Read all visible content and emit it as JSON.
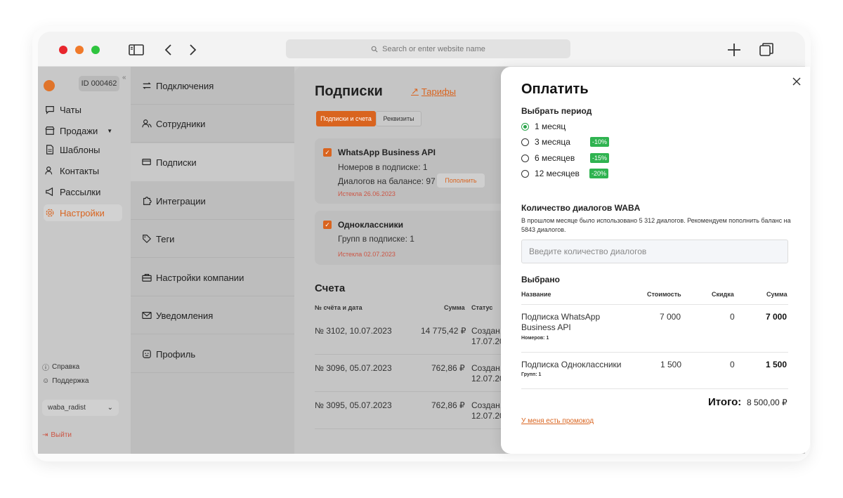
{
  "browser": {
    "address_placeholder": "Search or enter website name"
  },
  "left_nav": {
    "account_id": "ID 000462",
    "items": [
      {
        "label": "Чаты",
        "icon": "chat-icon"
      },
      {
        "label": "Продажи",
        "icon": "store-icon"
      },
      {
        "label": "Шаблоны",
        "icon": "document-icon"
      },
      {
        "label": "Контакты",
        "icon": "contacts-icon"
      },
      {
        "label": "Рассылки",
        "icon": "megaphone-icon"
      },
      {
        "label": "Настройки",
        "icon": "gear-icon"
      }
    ],
    "help": "Справка",
    "support": "Поддержка",
    "account_select": "waba_radist",
    "logout": "Выйти"
  },
  "settings_menu": [
    {
      "label": "Подключения",
      "icon": "swap-icon"
    },
    {
      "label": "Сотрудники",
      "icon": "users-icon"
    },
    {
      "label": "Подписки",
      "icon": "card-icon"
    },
    {
      "label": "Интеграции",
      "icon": "puzzle-icon"
    },
    {
      "label": "Теги",
      "icon": "tag-icon"
    },
    {
      "label": "Настройки компании",
      "icon": "briefcase-icon"
    },
    {
      "label": "Уведомления",
      "icon": "mail-icon"
    },
    {
      "label": "Профиль",
      "icon": "profile-icon"
    }
  ],
  "subscriptions": {
    "title": "Подписки",
    "tariffs_link": "Тарифы",
    "tabs": [
      "Подписки и счета",
      "Реквизиты"
    ],
    "cards": [
      {
        "title": "WhatsApp Business API",
        "line1": "Номеров в подписке: 1",
        "line2": "Диалогов на балансе: 97",
        "button": "Пополнить",
        "expired": "Истекла 26.06.2023"
      },
      {
        "title": "Одноклассники",
        "line1": "Групп в подписке: 1",
        "expired": "Истекла 02.07.2023"
      }
    ],
    "invoices_title": "Счета",
    "invoice_headers": [
      "№ счёта и дата",
      "Сумма",
      "Статус"
    ],
    "invoices": [
      {
        "number": "№ 3102, 10.07.2023",
        "amount": "14 775,42 ₽",
        "status": "Создан,",
        "status_date": "17.07.20"
      },
      {
        "number": "№ 3096, 05.07.2023",
        "amount": "762,86 ₽",
        "status": "Создан,",
        "status_date": "12.07.20"
      },
      {
        "number": "№ 3095, 05.07.2023",
        "amount": "762,86 ₽",
        "status": "Создан,",
        "status_date": "12.07.20"
      }
    ]
  },
  "pay_panel": {
    "title": "Оплатить",
    "period_label": "Выбрать период",
    "periods": [
      {
        "label": "1 месяц",
        "selected": true,
        "discount": ""
      },
      {
        "label": "3 месяца",
        "selected": false,
        "discount": "-10%"
      },
      {
        "label": "6 месяцев",
        "selected": false,
        "discount": "-15%"
      },
      {
        "label": "12 месяцев",
        "selected": false,
        "discount": "-20%"
      }
    ],
    "dialogs_label": "Количество диалогов WABA",
    "dialogs_note": "В прошлом месяце было использовано 5 312 диалогов. Рекомендуем пополнить баланс на 5843 диалогов.",
    "dialogs_placeholder": "Введите количество диалогов",
    "selected_label": "Выбрано",
    "table_headers": [
      "Название",
      "Стоимость",
      "Скидка",
      "Сумма"
    ],
    "rows": [
      {
        "name": "Подписка WhatsApp Business API",
        "sub": "Номеров: 1",
        "cost": "7 000",
        "discount": "0",
        "sum": "7 000"
      },
      {
        "name": "Подписка Одноклассники",
        "sub": "Групп: 1",
        "cost": "1 500",
        "discount": "0",
        "sum": "1 500"
      }
    ],
    "total_label": "Итого:",
    "total_value": "8 500,00 ₽",
    "promo_link": "У меня есть промокод"
  },
  "colors": {
    "accent": "#d9641f",
    "discount": "#2fb350",
    "overlay": "#c8c8c8"
  }
}
